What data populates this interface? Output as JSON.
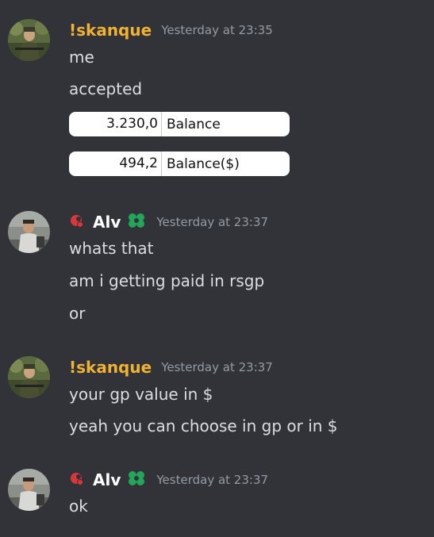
{
  "colors": {
    "background": "#313338",
    "text": "#dbdee1",
    "timestamp": "#949ba4",
    "user_skanque": "#f0b232",
    "user_alv": "#ffffff",
    "badge_green": "#23a55a",
    "badge_red": "#da373c"
  },
  "messages": [
    {
      "author": "!skanque",
      "timestamp": "Yesterday at 23:35",
      "lines": [
        "me",
        "accepted"
      ],
      "balances": [
        {
          "value": "3.230,0",
          "label": "Balance"
        },
        {
          "value": "494,2",
          "label": "Balance($)"
        }
      ]
    },
    {
      "author": "Alv",
      "timestamp": "Yesterday at 23:37",
      "icons": [
        "red-badge-icon",
        "green-clover-icon"
      ],
      "lines": [
        "whats that",
        "am i getting paid in rsgp",
        "or"
      ]
    },
    {
      "author": "!skanque",
      "timestamp": "Yesterday at 23:37",
      "lines": [
        "your gp value in $",
        "yeah you can choose in gp or in $"
      ]
    },
    {
      "author": "Alv",
      "timestamp": "Yesterday at 23:37",
      "icons": [
        "red-badge-icon",
        "green-clover-icon"
      ],
      "lines": [
        "ok"
      ]
    }
  ]
}
